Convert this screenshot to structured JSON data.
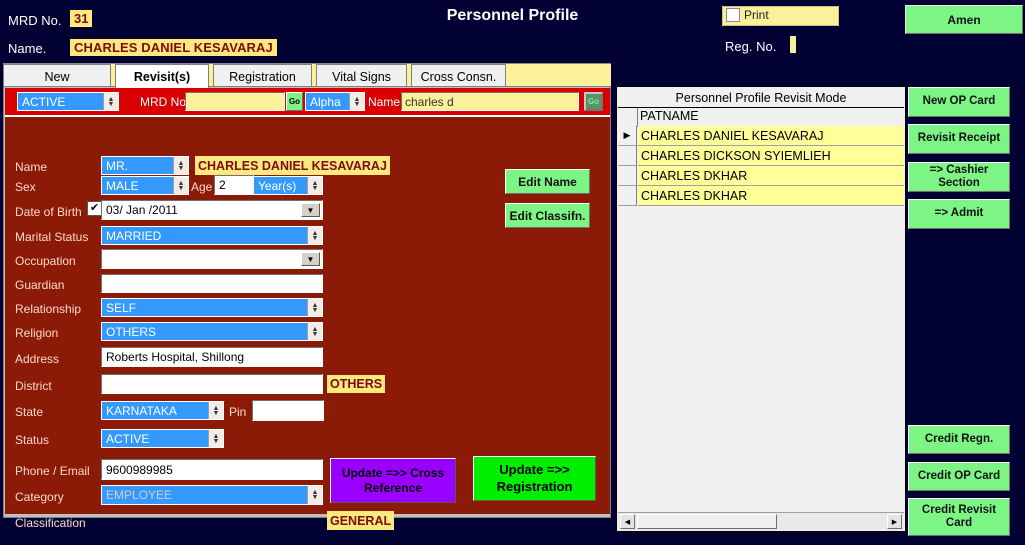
{
  "header": {
    "mrd_label": "MRD No.",
    "mrd_value": "31",
    "name_label": "Name.",
    "name_value": "CHARLES DANIEL KESAVARAJ",
    "title": "Personnel Profile",
    "print_label": "Print",
    "reg_label": "Reg. No.",
    "reg_value": "",
    "amend_label": "Amen"
  },
  "tabs": [
    {
      "label": "New",
      "active": false
    },
    {
      "label": "Revisit(s)",
      "active": true
    },
    {
      "label": "Registration",
      "active": false
    },
    {
      "label": "Vital Signs",
      "active": false
    },
    {
      "label": "Cross Consn.",
      "active": false
    }
  ],
  "search_bar": {
    "mode_value": "ACTIVE",
    "mrd_no_label": "MRD No",
    "mrd_no_value": "",
    "go_label": "Go",
    "alpha_value": "Alpha",
    "name_label": "Name",
    "name_value": "charles d",
    "go2_label": "Go"
  },
  "form": {
    "name_label": "Name",
    "title_value": "MR.",
    "name_display": "CHARLES DANIEL KESAVARAJ",
    "sex_label": "Sex",
    "sex_value": "MALE",
    "age_label": "Age",
    "age_value": "2",
    "age_unit": "Year(s)",
    "dob_label": "Date of Birth",
    "dob_checked": true,
    "dob_value": "03/ Jan /2011",
    "marital_label": "Marital Status",
    "marital_value": "MARRIED",
    "occupation_label": "Occupation",
    "occupation_value": "",
    "guardian_label": "Guardian",
    "guardian_value": "",
    "relationship_label": "Relationship",
    "relationship_value": "SELF",
    "religion_label": "Religion",
    "religion_value": "OTHERS",
    "address_label": "Address",
    "address_value": "Roberts Hospital, Shillong",
    "district_label": "District",
    "district_value": "",
    "district_tag": "OTHERS",
    "state_label": "State",
    "state_value": "KARNATAKA",
    "pin_label": "Pin",
    "pin_value": "",
    "status_label": "Status",
    "status_value": "ACTIVE",
    "phone_label": "Phone / Email",
    "phone_value": "9600989985",
    "category_label": "Category",
    "category_value": "EMPLOYEE",
    "classification_label": "Classification",
    "classification_value": "GENERAL",
    "edit_name_btn": "Edit Name",
    "edit_classifn_btn": "Edit Classifn.",
    "update_cross_btn": "Update =>> Cross Reference",
    "update_reg_btn": "Update =>> Registration"
  },
  "list_panel": {
    "title": "Personnel Profile Revisit Mode",
    "column_header": "PATNAME",
    "rows": [
      {
        "marker": "▶",
        "name": "CHARLES DANIEL KESAVARAJ"
      },
      {
        "marker": "",
        "name": "CHARLES DICKSON SYIEMLIEH"
      },
      {
        "marker": "",
        "name": "CHARLES DKHAR"
      },
      {
        "marker": "",
        "name": "CHARLES DKHAR"
      }
    ],
    "scroll_left": "◀",
    "scroll_right": "▶"
  },
  "side_buttons_top": [
    {
      "label": "New OP Card"
    },
    {
      "label": "Revisit Receipt"
    },
    {
      "label": "=> Cashier Section"
    },
    {
      "label": "=> Admit"
    }
  ],
  "side_buttons_bottom": [
    {
      "label": "Credit Regn."
    },
    {
      "label": "Credit OP Card"
    },
    {
      "label": "Credit Revisit Card"
    }
  ],
  "colors": {
    "window_bg": "#000033",
    "form_bg": "#8b1a06",
    "search_bar_bg": "#d80000",
    "accent_green": "#7cf584",
    "highlight_yellow": "#ffe97f",
    "combo_blue": "#3399ff",
    "purple_button": "#9900ff",
    "bright_green_button": "#00ee00"
  }
}
